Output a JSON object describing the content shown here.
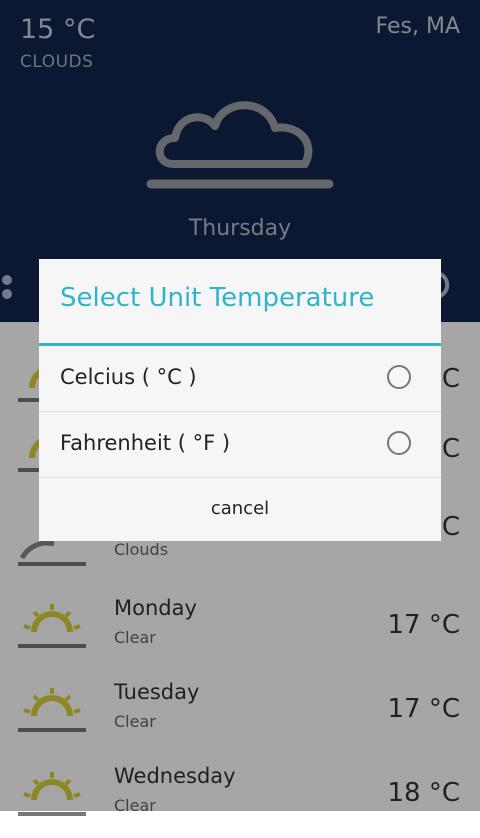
{
  "header": {
    "temperature": "15 °C",
    "condition": "CLOUDS",
    "city": "Fes, MA",
    "day": "Thursday",
    "icon": "cloud-icon"
  },
  "forecast": [
    {
      "day": "",
      "condition": "",
      "temp": "°C",
      "icon": "sun-icon"
    },
    {
      "day": "",
      "condition": "",
      "temp": "°C",
      "icon": "sun-icon"
    },
    {
      "day": "",
      "condition": "Clouds",
      "temp": "°C",
      "icon": "cloud-icon"
    },
    {
      "day": "Monday",
      "condition": "Clear",
      "temp": "17 °C",
      "icon": "sun-icon"
    },
    {
      "day": "Tuesday",
      "condition": "Clear",
      "temp": "17 °C",
      "icon": "sun-icon"
    },
    {
      "day": "Wednesday",
      "condition": "Clear",
      "temp": "18 °C",
      "icon": "sun-icon"
    }
  ],
  "dialog": {
    "title": "Select Unit Temperature",
    "options": [
      {
        "label": "Celcius ( °C )",
        "selected": false
      },
      {
        "label": "Fahrenheit ( °F )",
        "selected": false
      }
    ],
    "cancel_label": "cancel"
  },
  "colors": {
    "header_bg": "#13264d",
    "accent": "#2fb4cc",
    "sun": "#d9d23a"
  }
}
